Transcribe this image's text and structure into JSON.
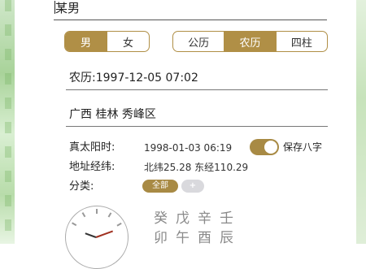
{
  "name_value": "某男",
  "gender_options": [
    "男",
    "女"
  ],
  "calendar_options": [
    "公历",
    "农历",
    "四柱"
  ],
  "lunar_date": "农历:1997-12-05 07:02",
  "place": "广西 桂林 秀峰区",
  "true_solar": {
    "label": "真太阳时:",
    "value": "1998-01-03 06:19"
  },
  "save_bazi": {
    "label": "保存八字",
    "checked": true
  },
  "coords": {
    "label": "地址经纬:",
    "value": "北纬25.28 东经110.29"
  },
  "category": {
    "label": "分类:",
    "all_chip": "全部",
    "add_chip": "+"
  },
  "bazi_stems": [
    "癸",
    "戊",
    "辛",
    "壬"
  ],
  "bazi_branches": [
    "卯",
    "午",
    "酉",
    "辰"
  ],
  "colors": {
    "accent": "#b08f46",
    "toggle": "#a88a44",
    "chip_inactive": "#d9d9dd"
  }
}
